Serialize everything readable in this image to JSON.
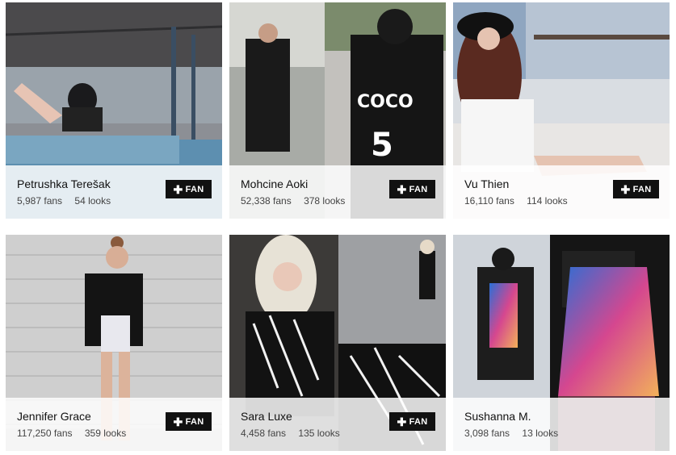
{
  "profiles": [
    {
      "name": "Petrushka Terešak",
      "fans": "5,987 fans",
      "looks": "54 looks",
      "fan_label": "FAN",
      "plus": "✚"
    },
    {
      "name": "Mohcine Aoki",
      "fans": "52,338 fans",
      "looks": "378 looks",
      "fan_label": "FAN",
      "plus": "✚"
    },
    {
      "name": "Vu Thien",
      "fans": "16,110 fans",
      "looks": "114 looks",
      "fan_label": "FAN",
      "plus": "✚"
    },
    {
      "name": "Jennifer Grace",
      "fans": "117,250 fans",
      "looks": "359 looks",
      "fan_label": "FAN",
      "plus": "✚"
    },
    {
      "name": "Sara Luxe",
      "fans": "4,458 fans",
      "looks": "135 looks",
      "fan_label": "FAN",
      "plus": "✚"
    },
    {
      "name": "Sushanna M.",
      "fans": "3,098 fans",
      "looks": "13 looks",
      "fan_label": "",
      "plus": ""
    }
  ],
  "colors": {
    "button_bg": "#111111",
    "button_text": "#ffffff",
    "overlay": "#ffffff"
  }
}
